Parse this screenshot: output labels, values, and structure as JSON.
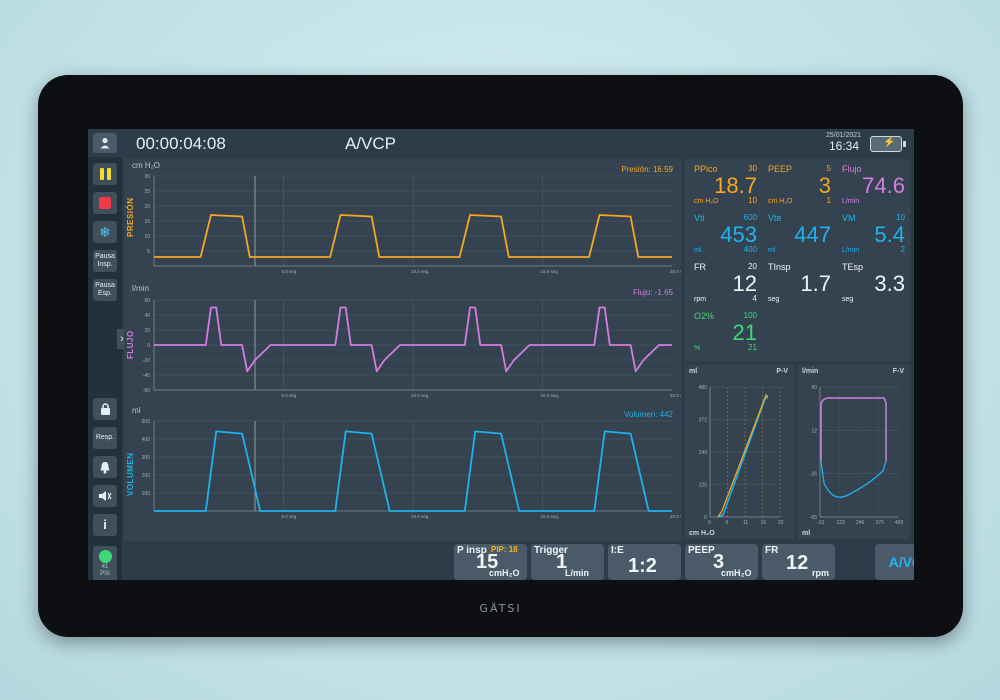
{
  "device": {
    "brand": "GÄTSI"
  },
  "header": {
    "timer": "00:00:04:08",
    "mode": "A/VCP",
    "date": "25/01/2021",
    "time": "16:34"
  },
  "sidebar": {
    "pausa_insp": [
      "Pausa",
      "Insp."
    ],
    "pausa_esp": [
      "Pausa",
      "Esp."
    ],
    "resp": "Resp.",
    "psi_value": "41",
    "psi_unit": "PSI"
  },
  "waves": {
    "pressure": {
      "unit": "cm H₂O",
      "axis_label": "PRESIÓN",
      "readout": "Presión: 16.59",
      "y_ticks": [
        "30",
        "25",
        "20",
        "15",
        "10",
        "5"
      ],
      "color": "#f5a623"
    },
    "flow": {
      "unit": "l/min",
      "axis_label": "FLUJO",
      "readout": "Flujo: -1.65",
      "y_ticks": [
        "60",
        "40",
        "20",
        "0",
        "-20",
        "-40",
        "-60"
      ],
      "color": "#d27ee0"
    },
    "volume": {
      "unit": "ml",
      "axis_label": "VOLUMEN",
      "readout": "Volumen: 442",
      "y_ticks": [
        "500",
        "400",
        "300",
        "200",
        "100"
      ],
      "color": "#1fb2ec"
    },
    "x_ticks": [
      "5.0 seg.",
      "10.0 seg.",
      "15.0 seg.",
      "20.0 seg."
    ]
  },
  "chart_data": [
    {
      "type": "line",
      "title": "",
      "ylabel": "cm H₂O",
      "ylim": [
        0,
        30
      ],
      "xlim": [
        0,
        20
      ],
      "series": [
        {
          "name": "Presión",
          "x": [
            0,
            1.8,
            2.2,
            3.4,
            3.7,
            5.5,
            6.8,
            7.2,
            8.4,
            8.7,
            10.5,
            11.8,
            12.2,
            13.4,
            13.7,
            15.5,
            16.8,
            17.2,
            18.4,
            18.7,
            20
          ],
          "y": [
            3,
            3,
            17,
            16.5,
            3,
            3,
            3,
            17,
            16.5,
            3,
            3,
            3,
            17,
            16.5,
            3,
            3,
            3,
            17,
            16.5,
            3,
            3
          ]
        }
      ]
    },
    {
      "type": "line",
      "title": "",
      "ylabel": "l/min",
      "ylim": [
        -60,
        60
      ],
      "xlim": [
        0,
        20
      ],
      "series": [
        {
          "name": "Flujo",
          "x": [
            0,
            2,
            2.2,
            2.4,
            2.6,
            3.4,
            3.6,
            3.9,
            4.5,
            7,
            7.2,
            7.4,
            7.6,
            8.4,
            8.6,
            8.9,
            9.5,
            12,
            12.2,
            12.4,
            12.6,
            13.4,
            13.6,
            13.9,
            14.5,
            17,
            17.2,
            17.4,
            17.6,
            18.4,
            18.6,
            18.9,
            19.5,
            20
          ],
          "y": [
            0,
            0,
            50,
            50,
            0,
            0,
            -35,
            -20,
            0,
            0,
            50,
            50,
            0,
            0,
            -35,
            -20,
            0,
            0,
            50,
            50,
            0,
            0,
            -35,
            -20,
            0,
            0,
            50,
            50,
            0,
            0,
            -35,
            -20,
            0,
            0
          ]
        }
      ]
    },
    {
      "type": "line",
      "title": "",
      "ylabel": "ml",
      "ylim": [
        0,
        500
      ],
      "xlim": [
        0,
        20
      ],
      "series": [
        {
          "name": "Volumen",
          "x": [
            0,
            2,
            2.4,
            3.4,
            4.1,
            5.5,
            7,
            7.4,
            8.4,
            9.1,
            10.5,
            12,
            12.4,
            13.4,
            14.1,
            15.5,
            17,
            17.4,
            18.4,
            19.1,
            20
          ],
          "y": [
            0,
            0,
            442,
            430,
            0,
            0,
            0,
            442,
            430,
            0,
            0,
            0,
            442,
            430,
            0,
            0,
            0,
            442,
            430,
            0,
            0
          ]
        }
      ]
    }
  ],
  "values": {
    "ppico": {
      "name": "PPico",
      "value": "18.7",
      "unit": "cm H₂O",
      "hi": "30",
      "lo": "10"
    },
    "peep": {
      "name": "PEEP",
      "value": "3",
      "unit": "cm H₂O",
      "hi": "5",
      "lo": "1"
    },
    "flujo": {
      "name": "Flujo",
      "value": "74.6",
      "unit": "L/min"
    },
    "vti": {
      "name": "Vti",
      "value": "453",
      "unit": "ml",
      "hi": "600",
      "lo": "400"
    },
    "vte": {
      "name": "Vte",
      "value": "447",
      "unit": "ml"
    },
    "vm": {
      "name": "VM",
      "value": "5.4",
      "unit": "L/min",
      "hi": "10",
      "lo": "2"
    },
    "fr": {
      "name": "FR",
      "value": "12",
      "unit": "rpm",
      "hi": "20",
      "lo": "4"
    },
    "tinsp": {
      "name": "TInsp",
      "value": "1.7",
      "unit": "seg"
    },
    "tesp": {
      "name": "TEsp",
      "value": "3.3",
      "unit": "seg"
    },
    "o2": {
      "name": "O2%",
      "value": "21",
      "unit": "%",
      "hi": "100",
      "lo": "21"
    }
  },
  "loops": {
    "pv": {
      "ylabel": "ml",
      "title": "P-V",
      "xlabel": "cm H₂O",
      "x_ticks": [
        "0",
        "5",
        "11",
        "16",
        "22"
      ],
      "y_ticks": [
        "480",
        "372",
        "249",
        "125",
        "0"
      ]
    },
    "fv": {
      "ylabel": "l/min",
      "title": "F-V",
      "xlabel": "ml",
      "x_ticks": [
        "-10",
        "123",
        "246",
        "370",
        "493"
      ],
      "y_ticks": [
        "50",
        "12",
        "-26",
        "-65"
      ]
    }
  },
  "bottom": {
    "pinsp": {
      "label": "P insp",
      "pip": "PIP: 18",
      "value": "15",
      "unit": "cmH₂O"
    },
    "trigger": {
      "label": "Trigger",
      "value": "1",
      "unit": "L/min"
    },
    "ie": {
      "label": "I:E",
      "value": "1:2"
    },
    "peep": {
      "label": "PEEP",
      "value": "3",
      "unit": "cmH₂O"
    },
    "fr": {
      "label": "FR",
      "value": "12",
      "unit": "rpm"
    },
    "mode": "A/VCP"
  }
}
